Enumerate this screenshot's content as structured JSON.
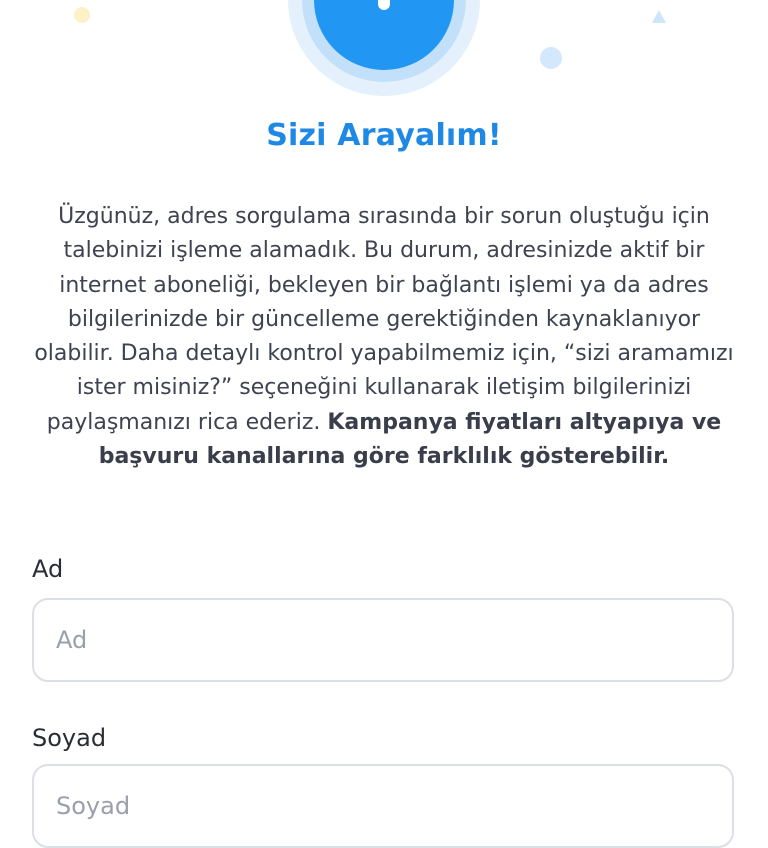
{
  "header": {
    "title": "Sizi Arayalım!"
  },
  "message": {
    "text": "Üzgünüz, adres sorgulama sırasında bir sorun oluştuğu için talebinizi işleme alamadık. Bu durum, adresinizde aktif bir internet aboneliği, bekleyen bir bağlantı işlemi ya da adres bilgilerinizde bir güncelleme gerektiğinden kaynaklanıyor olabilir. Daha detaylı kontrol yapabilmemiz için, “sizi aramamızı ister misiniz?” seçeneğini kullanarak iletişim bilgilerinizi paylaşmanızı rica ederiz.",
    "bold_text": "Kampanya fiyatları altyapıya ve başvuru kanallarına göre farklılık gösterebilir."
  },
  "form": {
    "first_name": {
      "label": "Ad",
      "placeholder": "Ad",
      "value": ""
    },
    "last_name": {
      "label": "Soyad",
      "placeholder": "Soyad",
      "value": ""
    }
  },
  "colors": {
    "accent": "#1e88e5",
    "illustration_blue": "#2196f3",
    "illustration_ring": "#d6ebfc",
    "confetti_yellow": "#fdf1c8",
    "confetti_blue": "#cfe6fa",
    "input_border": "#dcdfe6",
    "placeholder": "#9a9fab"
  },
  "icons": {
    "illustration": "info-circle-icon"
  }
}
